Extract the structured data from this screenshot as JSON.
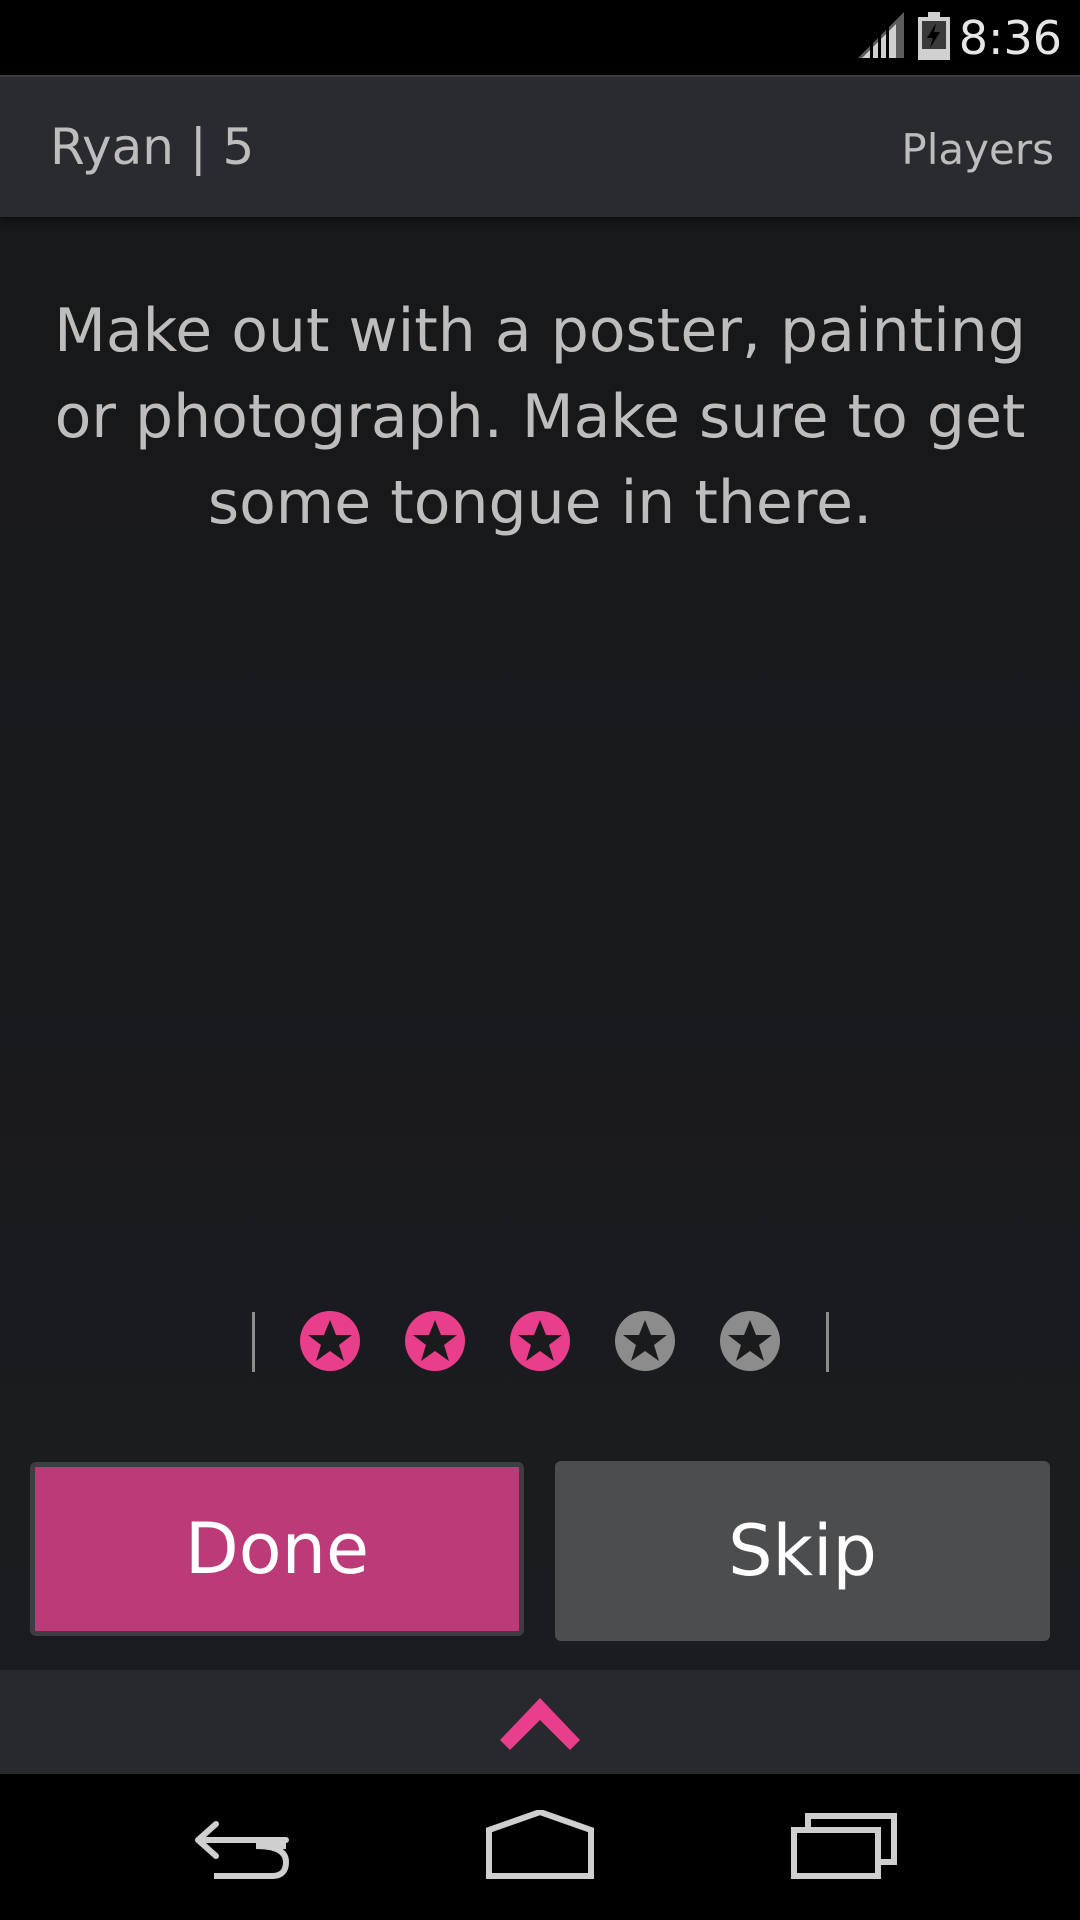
{
  "status_bar": {
    "time": "8:36",
    "icons": [
      "signal-icon",
      "battery-charging-icon"
    ]
  },
  "header": {
    "player_label": "Ryan | 5",
    "players_link": "Players"
  },
  "prompt": {
    "text": "Make out with a poster, painting or photograph. Make sure to get some tongue in there."
  },
  "rating": {
    "value": 3,
    "max": 5,
    "filled_color": "#e83e8c",
    "empty_color": "#8c8c8c"
  },
  "actions": {
    "done_label": "Done",
    "skip_label": "Skip"
  },
  "drawer": {
    "icon": "chevron-up-icon",
    "color": "#e83e8c"
  },
  "nav": {
    "icons": [
      "back-icon",
      "home-icon",
      "recents-icon"
    ]
  },
  "colors": {
    "accent": "#bd3a78",
    "background": "#1a1b1d",
    "header": "#2a2b2e"
  }
}
